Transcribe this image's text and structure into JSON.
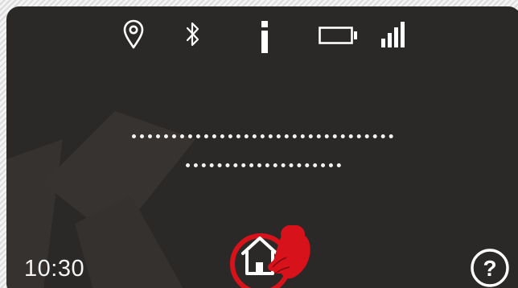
{
  "status_bar": {
    "icons": [
      "location-pin-icon",
      "bluetooth-icon",
      "info-icon",
      "battery-icon",
      "signal-strength-icon"
    ]
  },
  "clock": {
    "time": "10:30"
  },
  "footer": {
    "home_icon": "home-icon",
    "help_icon": "help-icon",
    "help_symbol": "?"
  },
  "colors": {
    "screen_background": "#2b2927",
    "icon_color": "#ffffff",
    "accent_red": "#d8121b",
    "watermark": "#3d3a37"
  }
}
